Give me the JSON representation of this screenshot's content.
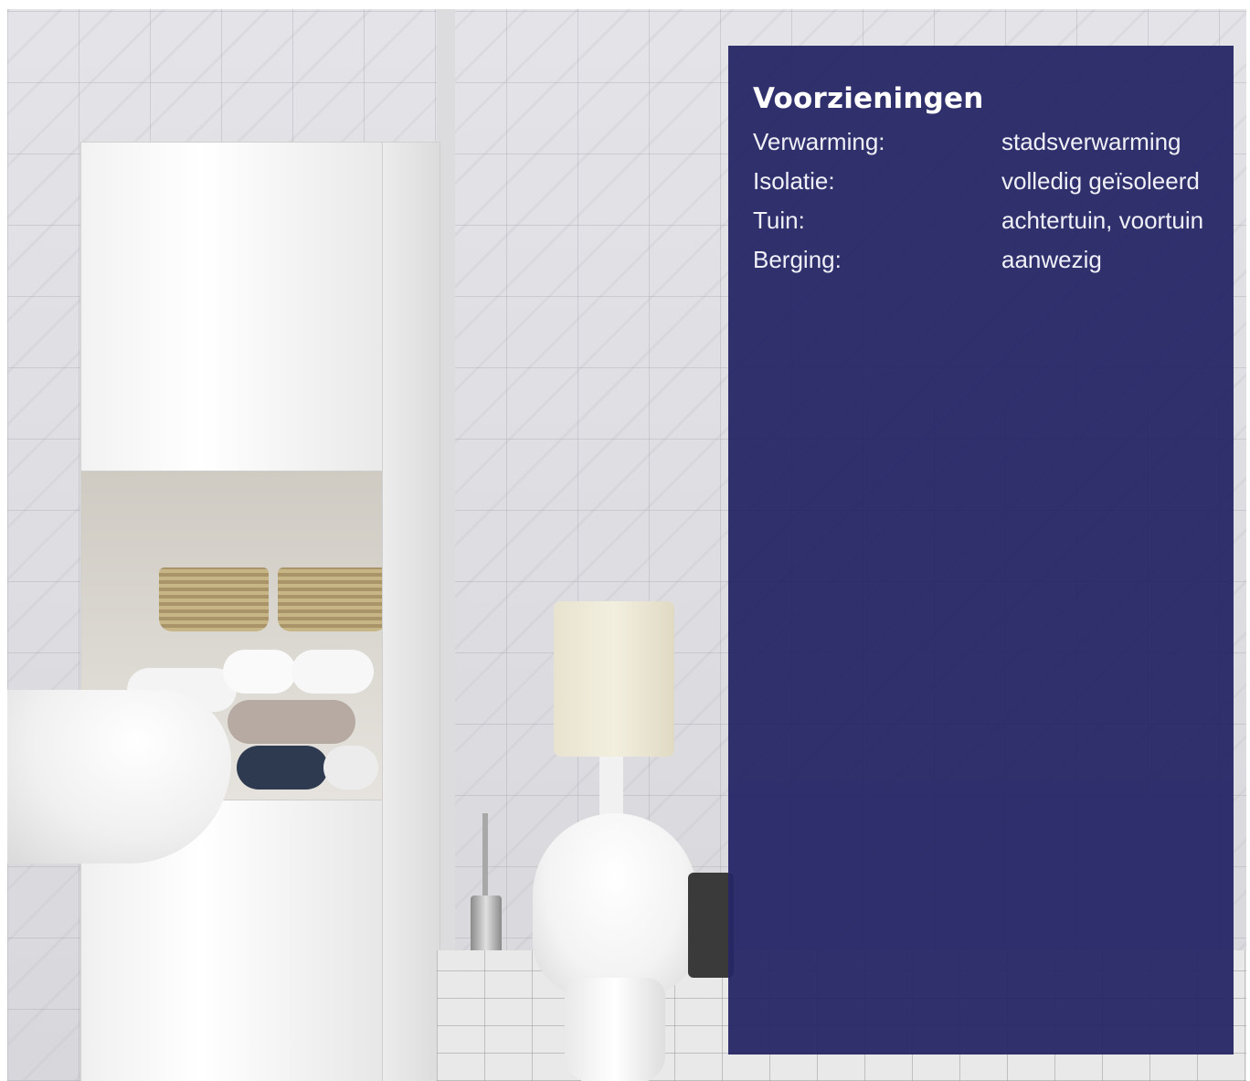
{
  "panel": {
    "title": "Voorzieningen",
    "rows": [
      {
        "label": "Verwarming:",
        "value": "stadsverwarming"
      },
      {
        "label": "Isolatie:",
        "value": "volledig geïsoleerd"
      },
      {
        "label": "Tuin:",
        "value": "achtertuin, voortuin"
      },
      {
        "label": "Berging:",
        "value": "aanwezig"
      }
    ]
  },
  "colors": {
    "panel_background": "#26266a",
    "panel_text": "#ffffff"
  }
}
